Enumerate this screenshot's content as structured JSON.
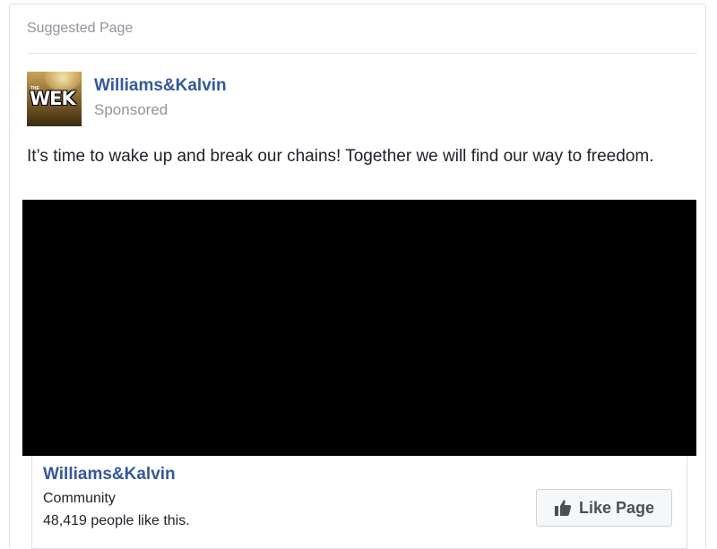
{
  "card": {
    "header_label": "Suggested Page"
  },
  "post": {
    "page_name": "Williams&Kalvin",
    "sponsored_label": "Sponsored",
    "avatar_logo_text": "WEK",
    "avatar_logo_small": "THE",
    "text": "It’s time to wake up and break our chains! Together we will find our way to freedom."
  },
  "footer": {
    "page_name": "Williams&Kalvin",
    "category": "Community",
    "likes": "48,419 people like this.",
    "like_button_label": "Like Page",
    "like_button_icon": "thumbs-up-icon"
  },
  "colors": {
    "link": "#365899",
    "muted": "#90949c",
    "media_background": "#000000",
    "button_background": "#f6f7f9"
  }
}
